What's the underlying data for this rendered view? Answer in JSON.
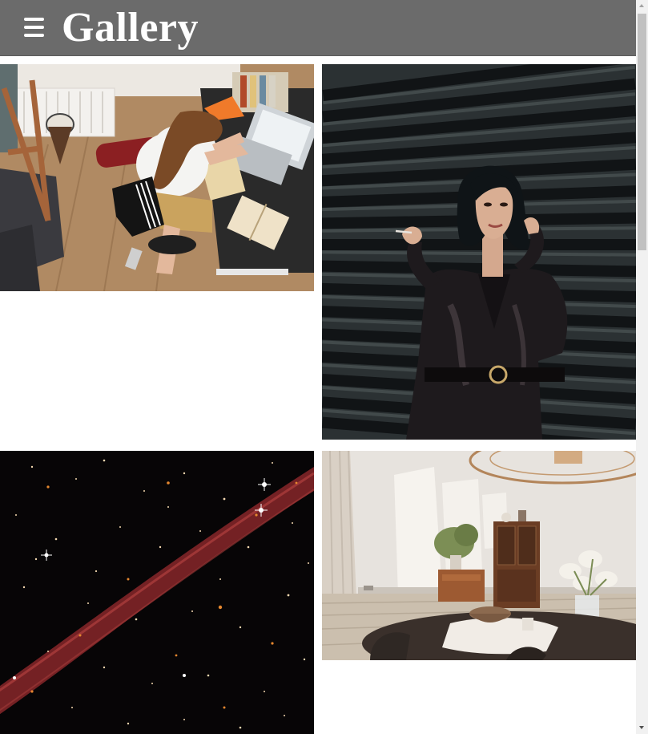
{
  "header": {
    "title": "Gallery",
    "menu_icon": "hamburger-menu-icon",
    "background_color": "#6b6b6b"
  },
  "gallery": {
    "photos": [
      {
        "name": "student-working-on-laptop"
      },
      {
        "name": "woman-in-black-satin-dress"
      },
      {
        "name": "starry-sky-with-red-streak"
      },
      {
        "name": "bright-dining-room-interior"
      }
    ]
  },
  "scrollbar": {
    "up_icon": "scroll-up-arrow-icon",
    "down_icon": "scroll-down-arrow-icon"
  }
}
